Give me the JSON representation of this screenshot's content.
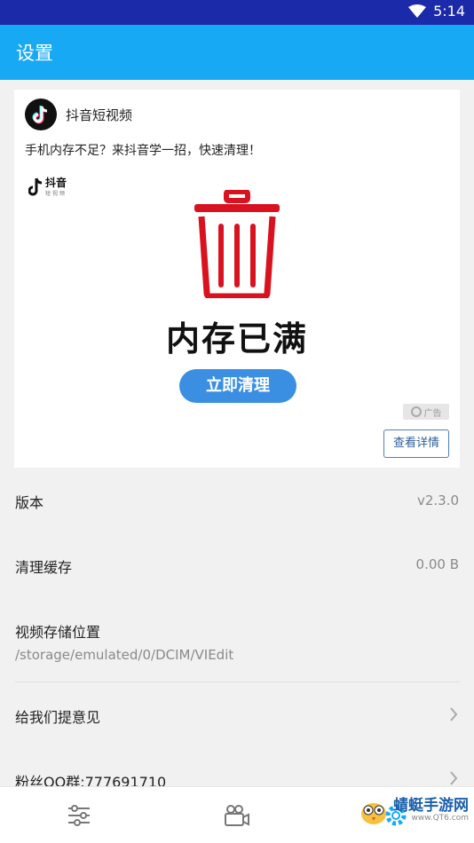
{
  "status_bar": {
    "time": "5:14"
  },
  "app_bar": {
    "title": "设置"
  },
  "ad": {
    "brand": "抖音短视频",
    "text": "手机内存不足？来抖音学一招，快速清理！",
    "small_logo_name": "抖音",
    "small_logo_sub": "短视频",
    "headline": "内存已满",
    "button_label": "立即清理",
    "badge_label": "广告",
    "detail_label": "查看详情",
    "trash_color": "#d9121f",
    "button_color": "#3a8fe3"
  },
  "settings": {
    "version": {
      "label": "版本",
      "value": "v2.3.0"
    },
    "cache": {
      "label": "清理缓存",
      "value": "0.00 B"
    },
    "storage": {
      "label": "视频存储位置",
      "path": "/storage/emulated/0/DCIM/VIEdit"
    },
    "feedback": {
      "label": "给我们提意见"
    },
    "qq_group": {
      "label": "粉丝QQ群:777691710"
    }
  },
  "bottom_nav": {
    "items": [
      {
        "name": "settings-sliders-icon"
      },
      {
        "name": "video-camera-icon"
      },
      {
        "name": "gear-icon"
      }
    ],
    "active_color": "#18a9f5"
  },
  "watermark": {
    "title": "蜻蜓手游网",
    "sub": "www.QT6.com"
  },
  "colors": {
    "app_bar": "#18a9f5",
    "status_bar": "#1a2aa8",
    "background": "#f1f1f1"
  }
}
